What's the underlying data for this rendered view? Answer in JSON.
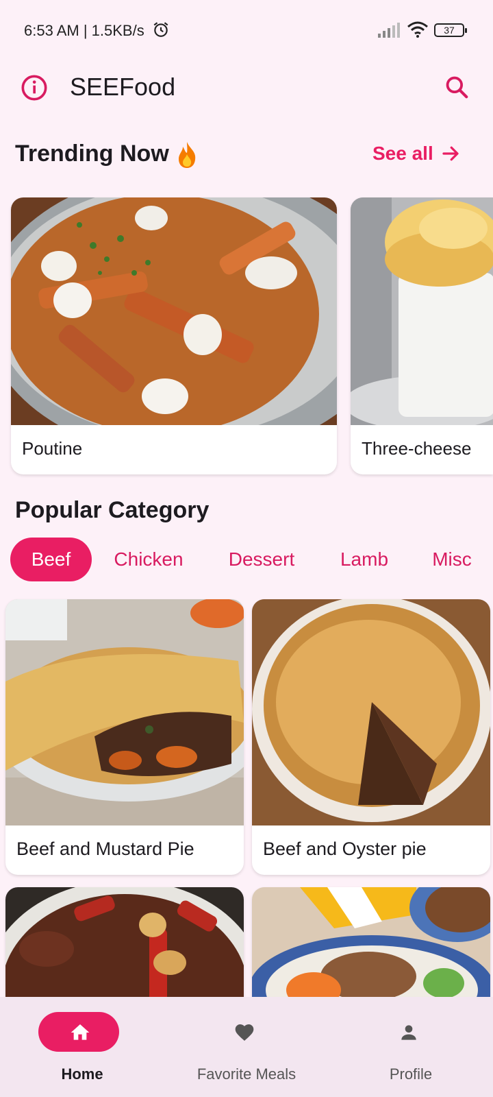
{
  "status_bar": {
    "time_text": "6:53 AM | 1.5KB/s",
    "battery": "37"
  },
  "top_bar": {
    "title": "SEEFood"
  },
  "trending": {
    "title": "Trending Now",
    "see_all": "See all",
    "items": [
      {
        "label": "Poutine"
      },
      {
        "label": "Three-cheese"
      }
    ]
  },
  "popular": {
    "title": "Popular Category",
    "categories": [
      "Beef",
      "Chicken",
      "Dessert",
      "Lamb",
      "Misc"
    ],
    "selected": "Beef",
    "meals": [
      {
        "label": "Beef and Mustard Pie"
      },
      {
        "label": "Beef and Oyster pie"
      }
    ]
  },
  "bottom_nav": {
    "items": [
      {
        "label": "Home",
        "icon": "home-icon",
        "active": true
      },
      {
        "label": "Favorite Meals",
        "icon": "heart-icon",
        "active": false
      },
      {
        "label": "Profile",
        "icon": "person-icon",
        "active": false
      }
    ]
  },
  "colors": {
    "accent": "#e91e63",
    "background": "#fdf1f8",
    "nav_background": "#f3e6f0"
  }
}
